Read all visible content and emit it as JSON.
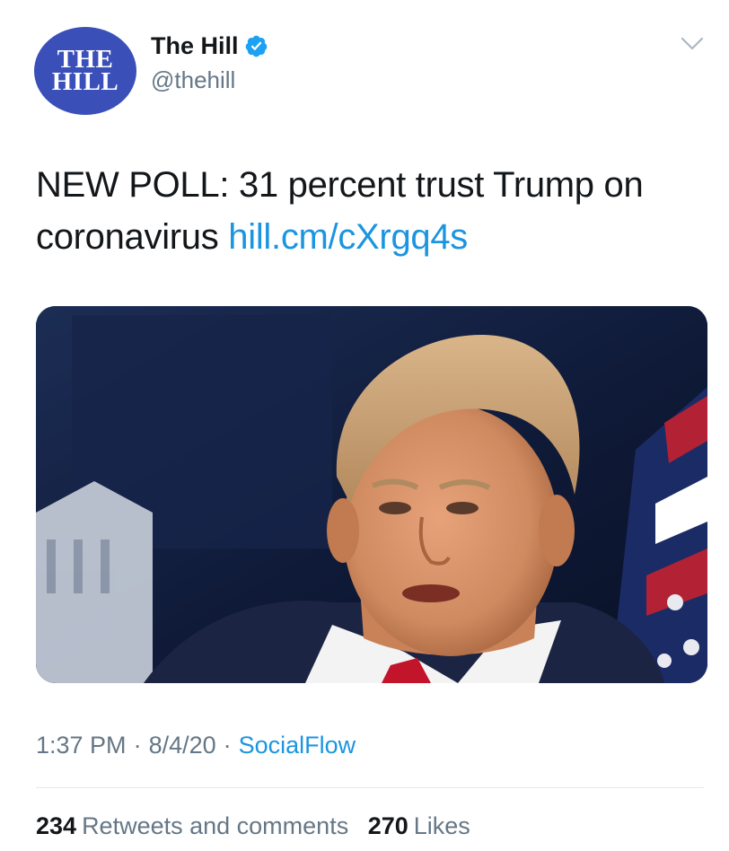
{
  "account": {
    "avatar_line1": "THE",
    "avatar_line2": "HILL",
    "display_name": "The Hill",
    "handle": "@thehill",
    "verified_icon": "verified-badge-icon",
    "menu_icon": "chevron-down-icon"
  },
  "tweet": {
    "text": "NEW POLL: 31 percent trust Trump on coronavirus",
    "link": "hill.cm/cXrgq4s",
    "image_description_icon": "photo"
  },
  "meta": {
    "time": "1:37 PM",
    "separator": "·",
    "date": "8/4/20",
    "source": "SocialFlow"
  },
  "stats": {
    "retweets_count": "234",
    "retweets_label": "Retweets and comments",
    "likes_count": "270",
    "likes_label": "Likes"
  },
  "colors": {
    "link": "#1b95e0",
    "secondary_text": "#657786",
    "avatar_bg": "#3a4fb8",
    "verified": "#1da1f2"
  }
}
